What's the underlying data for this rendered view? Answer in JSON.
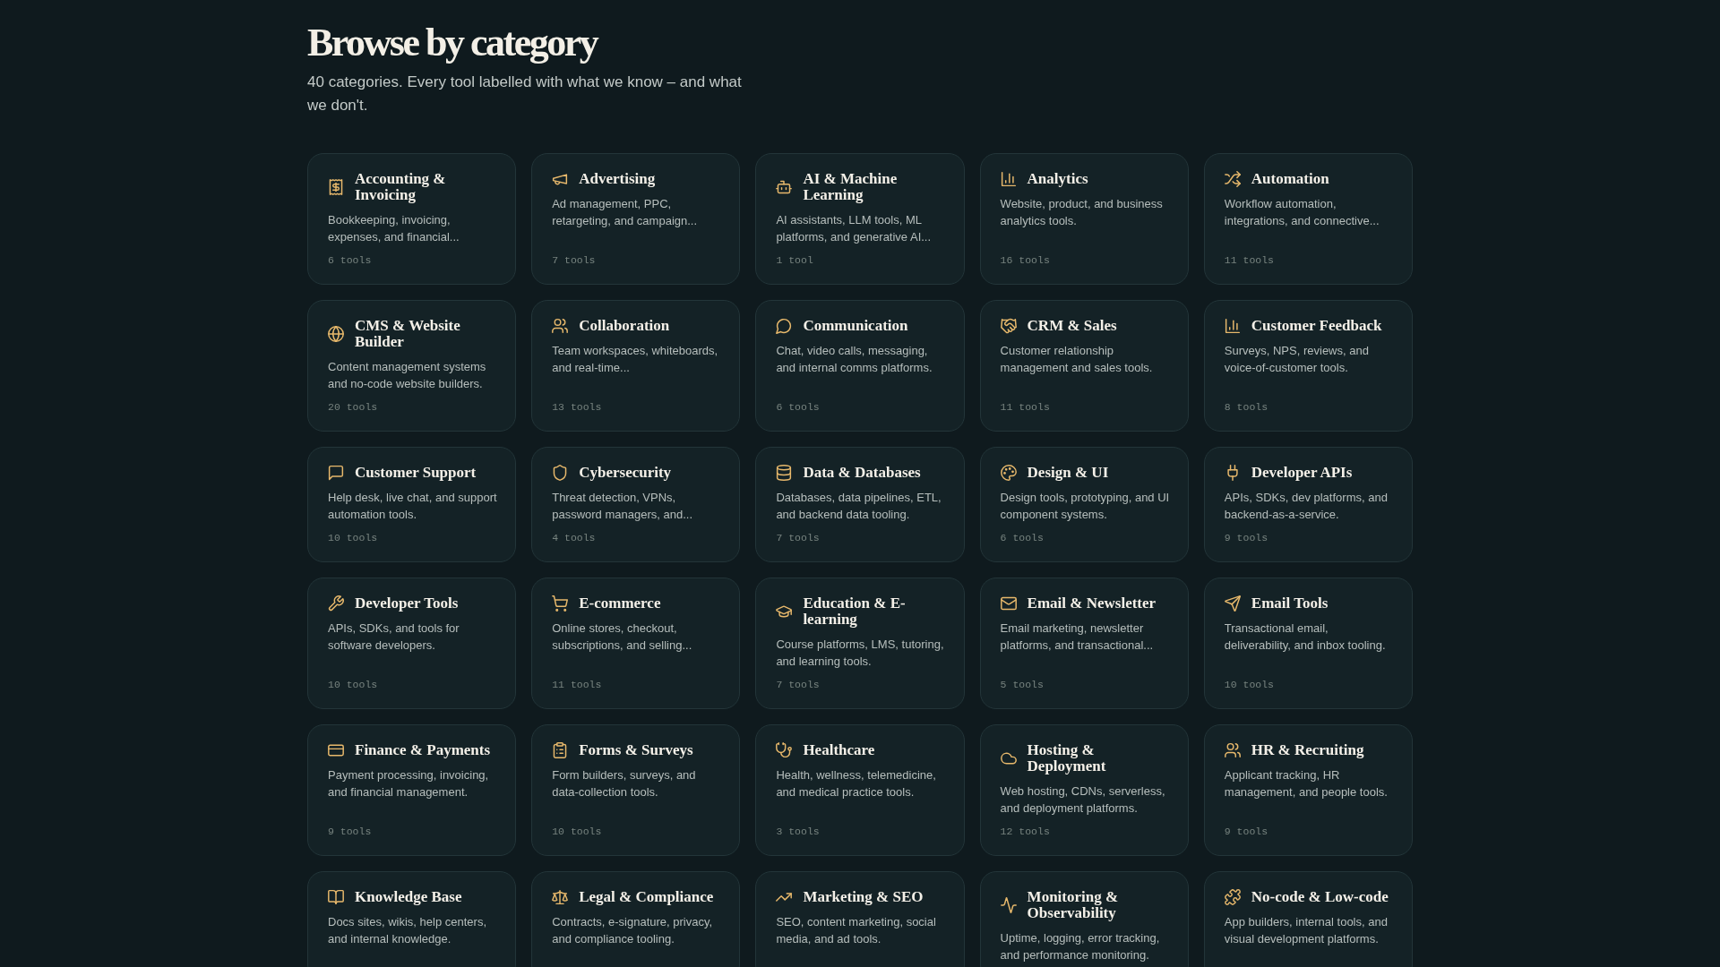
{
  "header": {
    "title": "Browse by category",
    "subtitle": "40 categories. Every tool labelled with what we know – and what we don't."
  },
  "categories": [
    {
      "name": "Accounting & Invoicing",
      "description": "Bookkeeping, invoicing, expenses, and financial...",
      "count": "6 tools"
    },
    {
      "name": "Advertising",
      "description": "Ad management, PPC, retargeting, and campaign...",
      "count": "7 tools"
    },
    {
      "name": "AI & Machine Learning",
      "description": "AI assistants, LLM tools, ML platforms, and generative AI...",
      "count": "1 tool"
    },
    {
      "name": "Analytics",
      "description": "Website, product, and business analytics tools.",
      "count": "16 tools"
    },
    {
      "name": "Automation",
      "description": "Workflow automation, integrations, and connective...",
      "count": "11 tools"
    },
    {
      "name": "CMS & Website Builder",
      "description": "Content management systems and no-code website builders.",
      "count": "20 tools"
    },
    {
      "name": "Collaboration",
      "description": "Team workspaces, whiteboards, and real-time...",
      "count": "13 tools"
    },
    {
      "name": "Communication",
      "description": "Chat, video calls, messaging, and internal comms platforms.",
      "count": "6 tools"
    },
    {
      "name": "CRM & Sales",
      "description": "Customer relationship management and sales tools.",
      "count": "11 tools"
    },
    {
      "name": "Customer Feedback",
      "description": "Surveys, NPS, reviews, and voice-of-customer tools.",
      "count": "8 tools"
    },
    {
      "name": "Customer Support",
      "description": "Help desk, live chat, and support automation tools.",
      "count": "10 tools"
    },
    {
      "name": "Cybersecurity",
      "description": "Threat detection, VPNs, password managers, and...",
      "count": "4 tools"
    },
    {
      "name": "Data & Databases",
      "description": "Databases, data pipelines, ETL, and backend data tooling.",
      "count": "7 tools"
    },
    {
      "name": "Design & UI",
      "description": "Design tools, prototyping, and UI component systems.",
      "count": "6 tools"
    },
    {
      "name": "Developer APIs",
      "description": "APIs, SDKs, dev platforms, and backend-as-a-service.",
      "count": "9 tools"
    },
    {
      "name": "Developer Tools",
      "description": "APIs, SDKs, and tools for software developers.",
      "count": "10 tools"
    },
    {
      "name": "E-commerce",
      "description": "Online stores, checkout, subscriptions, and selling...",
      "count": "11 tools"
    },
    {
      "name": "Education & E-learning",
      "description": "Course platforms, LMS, tutoring, and learning tools.",
      "count": "7 tools"
    },
    {
      "name": "Email & Newsletter",
      "description": "Email marketing, newsletter platforms, and transactional...",
      "count": "5 tools"
    },
    {
      "name": "Email Tools",
      "description": "Transactional email, deliverability, and inbox tooling.",
      "count": "10 tools"
    },
    {
      "name": "Finance & Payments",
      "description": "Payment processing, invoicing, and financial management.",
      "count": "9 tools"
    },
    {
      "name": "Forms & Surveys",
      "description": "Form builders, surveys, and data-collection tools.",
      "count": "10 tools"
    },
    {
      "name": "Healthcare",
      "description": "Health, wellness, telemedicine, and medical practice tools.",
      "count": "3 tools"
    },
    {
      "name": "Hosting & Deployment",
      "description": "Web hosting, CDNs, serverless, and deployment platforms.",
      "count": "12 tools"
    },
    {
      "name": "HR & Recruiting",
      "description": "Applicant tracking, HR management, and people tools.",
      "count": "9 tools"
    },
    {
      "name": "Knowledge Base",
      "description": "Docs sites, wikis, help centers, and internal knowledge."
    },
    {
      "name": "Legal & Compliance",
      "description": "Contracts, e-signature, privacy, and compliance tooling."
    },
    {
      "name": "Marketing & SEO",
      "description": "SEO, content marketing, social media, and ad tools."
    },
    {
      "name": "Monitoring & Observability",
      "description": "Uptime, logging, error tracking, and performance monitoring."
    },
    {
      "name": "No-code & Low-code",
      "description": "App builders, internal tools, and visual development platforms."
    }
  ]
}
